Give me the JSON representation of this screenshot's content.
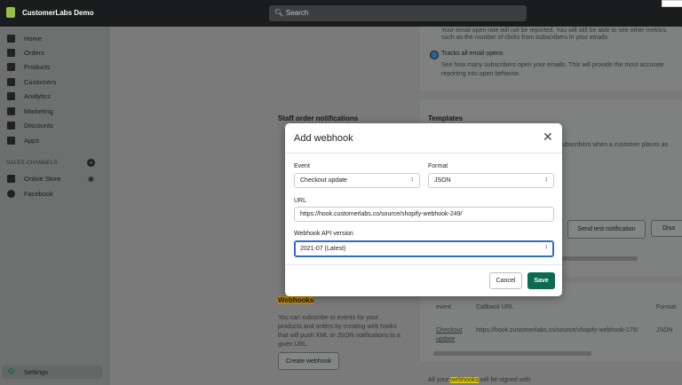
{
  "topbar": {
    "store_name": "CustomerLabs Demo",
    "search_placeholder": "Search",
    "search_icon": "search-icon"
  },
  "sidebar": {
    "items": [
      {
        "label": "Home",
        "icon": "home-icon"
      },
      {
        "label": "Orders",
        "icon": "orders-icon"
      },
      {
        "label": "Products",
        "icon": "tag-icon"
      },
      {
        "label": "Customers",
        "icon": "person-icon"
      },
      {
        "label": "Analytics",
        "icon": "bar-chart-icon"
      },
      {
        "label": "Marketing",
        "icon": "megaphone-icon"
      },
      {
        "label": "Discounts",
        "icon": "discount-icon"
      },
      {
        "label": "Apps",
        "icon": "apps-icon"
      }
    ],
    "sales_channels_heading": "SALES CHANNELS",
    "channels": [
      {
        "label": "Online Store",
        "icon": "store-icon"
      },
      {
        "label": "Facebook",
        "icon": "facebook-icon"
      }
    ],
    "settings_label": "Settings"
  },
  "background": {
    "open_rate_line1": "Your email open rate will not be reported. You will still be able to see other metrics,",
    "open_rate_line2": "such as the number of clicks from subscribers in your emails.",
    "tracks_label": "Tracks all email opens",
    "tracks_desc1": "See how many subscribers open your emails. This will provide the most accurate",
    "tracks_desc2": "reporting into open behavior.",
    "staff_heading": "Staff order notifications",
    "templates_heading": "Templates",
    "templates_frag": "ubscribers when a customer places an",
    "send_test": "Send test notification",
    "disable": "Disa",
    "webhooks_heading": "Webhooks",
    "webhooks_desc": [
      "You can subscribe to events for your",
      "products and orders by creating web hooks",
      "that will push XML or JSON notifications to a",
      "given URL."
    ],
    "create_webhook": "Create webhook",
    "table_headers": [
      "event",
      "Callback URL",
      "Format"
    ],
    "table_row": {
      "event_line1": "Checkout",
      "event_line2": "update",
      "url": "https://hook.customerlabs.co/source/shopify-webhook-175/",
      "format": "JSON"
    },
    "signed_prefix": "All your",
    "signed_highlight": "webhooks",
    "signed_suffix": "will be signed with"
  },
  "modal": {
    "title": "Add webhook",
    "event_label": "Event",
    "event_value": "Checkout update",
    "format_label": "Format",
    "format_value": "JSON",
    "url_label": "URL",
    "url_value": "https://hook.customerlabs.co/source/shopify-webhook-249/",
    "api_label": "Webhook API version",
    "api_value": "2021-07 (Latest)",
    "cancel_label": "Cancel",
    "save_label": "Save"
  }
}
